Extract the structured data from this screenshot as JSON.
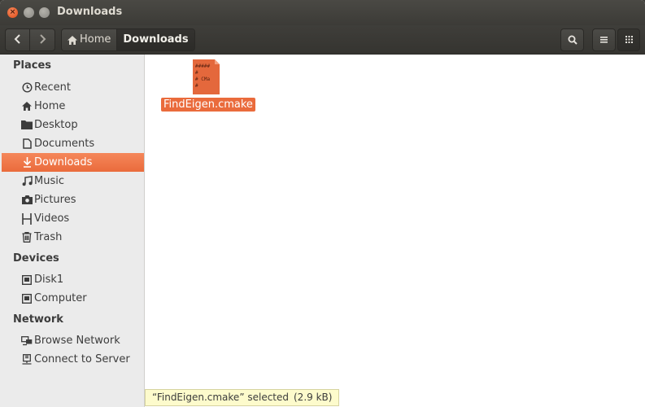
{
  "window": {
    "title": "Downloads"
  },
  "toolbar": {
    "breadcrumbs": [
      {
        "label": "Home",
        "icon": "home-icon"
      },
      {
        "label": "Downloads"
      }
    ]
  },
  "sidebar": {
    "places_heading": "Places",
    "places": [
      {
        "label": "Recent",
        "icon": "clock-icon"
      },
      {
        "label": "Home",
        "icon": "home-icon"
      },
      {
        "label": "Desktop",
        "icon": "folder-icon"
      },
      {
        "label": "Documents",
        "icon": "document-icon"
      },
      {
        "label": "Downloads",
        "icon": "download-icon",
        "selected": true
      },
      {
        "label": "Music",
        "icon": "music-icon"
      },
      {
        "label": "Pictures",
        "icon": "camera-icon"
      },
      {
        "label": "Videos",
        "icon": "film-icon"
      },
      {
        "label": "Trash",
        "icon": "trash-icon"
      }
    ],
    "devices_heading": "Devices",
    "devices": [
      {
        "label": "Disk1",
        "icon": "drive-icon"
      },
      {
        "label": "Computer",
        "icon": "drive-icon"
      }
    ],
    "network_heading": "Network",
    "network": [
      {
        "label": "Browse Network",
        "icon": "network-icon"
      },
      {
        "label": "Connect to Server",
        "icon": "server-icon"
      }
    ]
  },
  "files": [
    {
      "name": "FindEigen.cmake",
      "icon_text": [
        "#####",
        "#",
        "# CMa",
        "#"
      ],
      "selected": true
    }
  ],
  "status": {
    "selection": "“FindEigen.cmake” selected",
    "size": "(2.9 kB)"
  },
  "colors": {
    "accent": "#ea6b3c",
    "titlebar": "#3c3b37",
    "sidebar": "#ebebeb",
    "status_bg": "#fdfbcc"
  }
}
